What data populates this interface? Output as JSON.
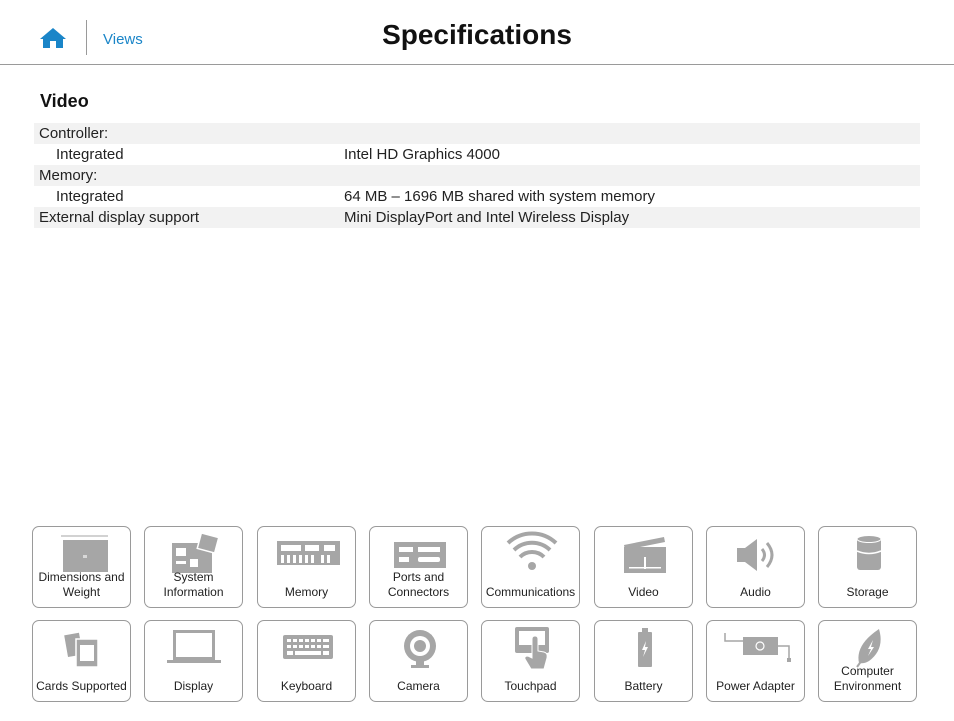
{
  "header": {
    "title": "Specifications",
    "views_label": "Views"
  },
  "section": {
    "title": "Video"
  },
  "specs": [
    {
      "label": "Controller:",
      "value": "",
      "sub": false
    },
    {
      "label": "Integrated",
      "value": "Intel HD Graphics 4000",
      "sub": true
    },
    {
      "label": "Memory:",
      "value": "",
      "sub": false
    },
    {
      "label": "Integrated",
      "value": "64 MB – 1696 MB shared with system memory",
      "sub": true
    },
    {
      "label": "External display support",
      "value": "Mini DisplayPort and Intel Wireless Display",
      "sub": false
    }
  ],
  "tiles": [
    {
      "label": "Dimensions and Weight",
      "icon": "laptop-dimensions-icon"
    },
    {
      "label": "System Information",
      "icon": "motherboard-icon"
    },
    {
      "label": "Memory",
      "icon": "memory-module-icon"
    },
    {
      "label": "Ports and Connectors",
      "icon": "ports-icon"
    },
    {
      "label": "Communications",
      "icon": "wifi-icon"
    },
    {
      "label": "Video",
      "icon": "clapperboard-icon"
    },
    {
      "label": "Audio",
      "icon": "speaker-icon"
    },
    {
      "label": "Storage",
      "icon": "storage-cylinder-icon"
    },
    {
      "label": "Cards Supported",
      "icon": "memory-cards-icon"
    },
    {
      "label": "Display",
      "icon": "monitor-icon"
    },
    {
      "label": "Keyboard",
      "icon": "keyboard-icon"
    },
    {
      "label": "Camera",
      "icon": "webcam-icon"
    },
    {
      "label": "Touchpad",
      "icon": "touchpad-icon"
    },
    {
      "label": "Battery",
      "icon": "battery-icon"
    },
    {
      "label": "Power Adapter",
      "icon": "power-adapter-icon"
    },
    {
      "label": "Computer Environment",
      "icon": "leaf-icon"
    }
  ],
  "colors": {
    "accent": "#1a85c8",
    "icon_gray": "#a6a6a6",
    "row_shade": "#f2f2f2"
  }
}
